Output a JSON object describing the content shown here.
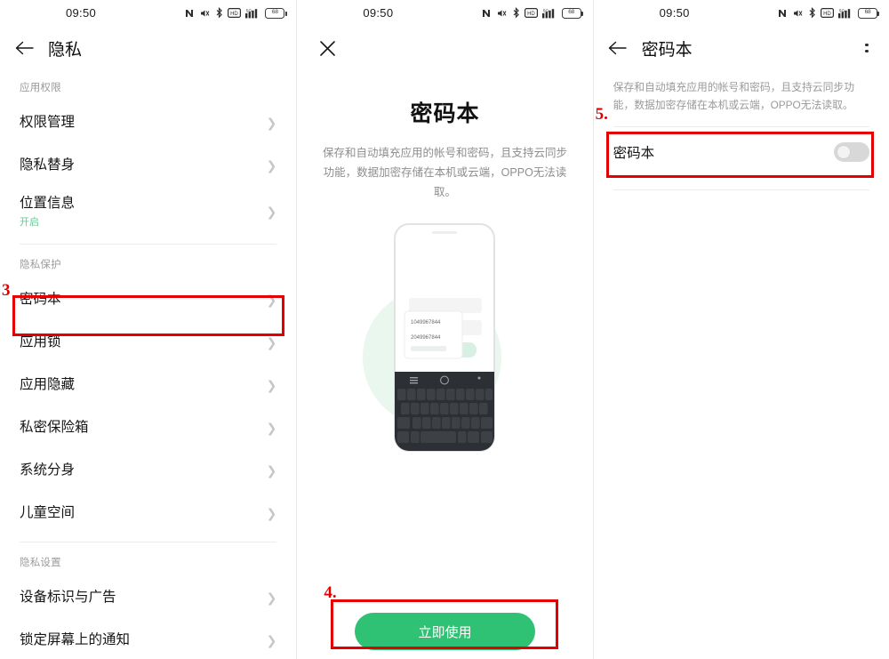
{
  "statusbar": {
    "time": "09:50",
    "battery_percent": "68",
    "icons": [
      "nfc-icon",
      "mute-icon",
      "bluetooth-icon",
      "hd-voice-icon",
      "signal-5g-icon",
      "battery-icon"
    ]
  },
  "panel1": {
    "title": "隐私",
    "back_icon": "back-arrow-icon",
    "groups": [
      {
        "label": "应用权限",
        "items": [
          {
            "label": "权限管理",
            "sub": ""
          },
          {
            "label": "隐私替身",
            "sub": ""
          },
          {
            "label": "位置信息",
            "sub": "开启"
          }
        ]
      },
      {
        "label": "隐私保护",
        "items": [
          {
            "label": "密码本",
            "sub": ""
          },
          {
            "label": "应用锁",
            "sub": ""
          },
          {
            "label": "应用隐藏",
            "sub": ""
          },
          {
            "label": "私密保险箱",
            "sub": ""
          },
          {
            "label": "系统分身",
            "sub": ""
          },
          {
            "label": "儿童空间",
            "sub": ""
          }
        ]
      },
      {
        "label": "隐私设置",
        "items": [
          {
            "label": "设备标识与广告",
            "sub": ""
          },
          {
            "label": "锁定屏幕上的通知",
            "sub": ""
          }
        ]
      }
    ],
    "annotation": {
      "number": "3"
    }
  },
  "panel2": {
    "close_icon": "close-x-icon",
    "title": "密码本",
    "description": "保存和自动填充应用的帐号和密码，且支持云同步功能，数据加密存储在本机或云端，OPPO无法读取。",
    "illustration": {
      "name": "phone-autofill-illustration",
      "suggestion_1": "1049967844",
      "suggestion_2": "2049967844"
    },
    "cta_label": "立即使用",
    "annotation": {
      "number": "4."
    }
  },
  "panel3": {
    "back_icon": "back-arrow-icon",
    "title": "密码本",
    "menu_icon": "more-options-icon",
    "description": "保存和自动填充应用的帐号和密码，且支持云同步功能，数据加密存储在本机或云端，OPPO无法读取。",
    "row_label": "密码本",
    "toggle_state": "off",
    "annotation": {
      "number": "5."
    }
  },
  "colors": {
    "accent_green": "#2fc275",
    "sub_green": "#5ec994",
    "highlight_red": "#e40000",
    "text_primary": "#141414",
    "text_muted": "#9a9a9a"
  }
}
